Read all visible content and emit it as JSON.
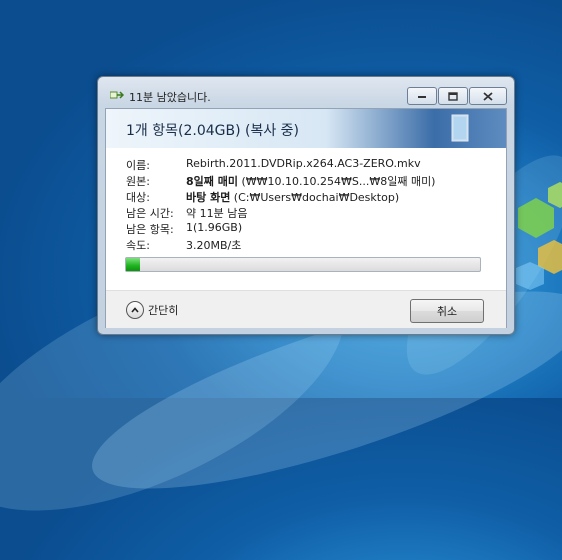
{
  "window": {
    "title": "11분 남았습니다.",
    "header_title": "1개 항목(2.04GB) (복사 중)"
  },
  "info": {
    "rows": [
      {
        "label": "이름:",
        "value": "Rebirth.2011.DVDRip.x264.AC3-ZERO.mkv",
        "bold": ""
      },
      {
        "label": "원본:",
        "bold": "8일째 매미",
        "value": " (₩₩10.10.10.254₩S...₩8일째 매미)"
      },
      {
        "label": "대상:",
        "bold": "바탕 화면",
        "value": " (C:₩Users₩dochai₩Desktop)"
      },
      {
        "label": "남은 시간:",
        "value": "약 11분 남음",
        "bold": ""
      },
      {
        "label": "남은 항목:",
        "value": "1(1.96GB)",
        "bold": ""
      },
      {
        "label": "속도:",
        "value": "3.20MB/초",
        "bold": ""
      }
    ]
  },
  "progress": {
    "fraction": 0.04,
    "color": "#1fb21f"
  },
  "footer": {
    "collapse_label": "간단히",
    "cancel_label": "취소"
  },
  "icons": [
    "copy-icon",
    "minimize-icon",
    "maximize-icon",
    "close-icon",
    "document-icon",
    "chevron-up-icon"
  ]
}
